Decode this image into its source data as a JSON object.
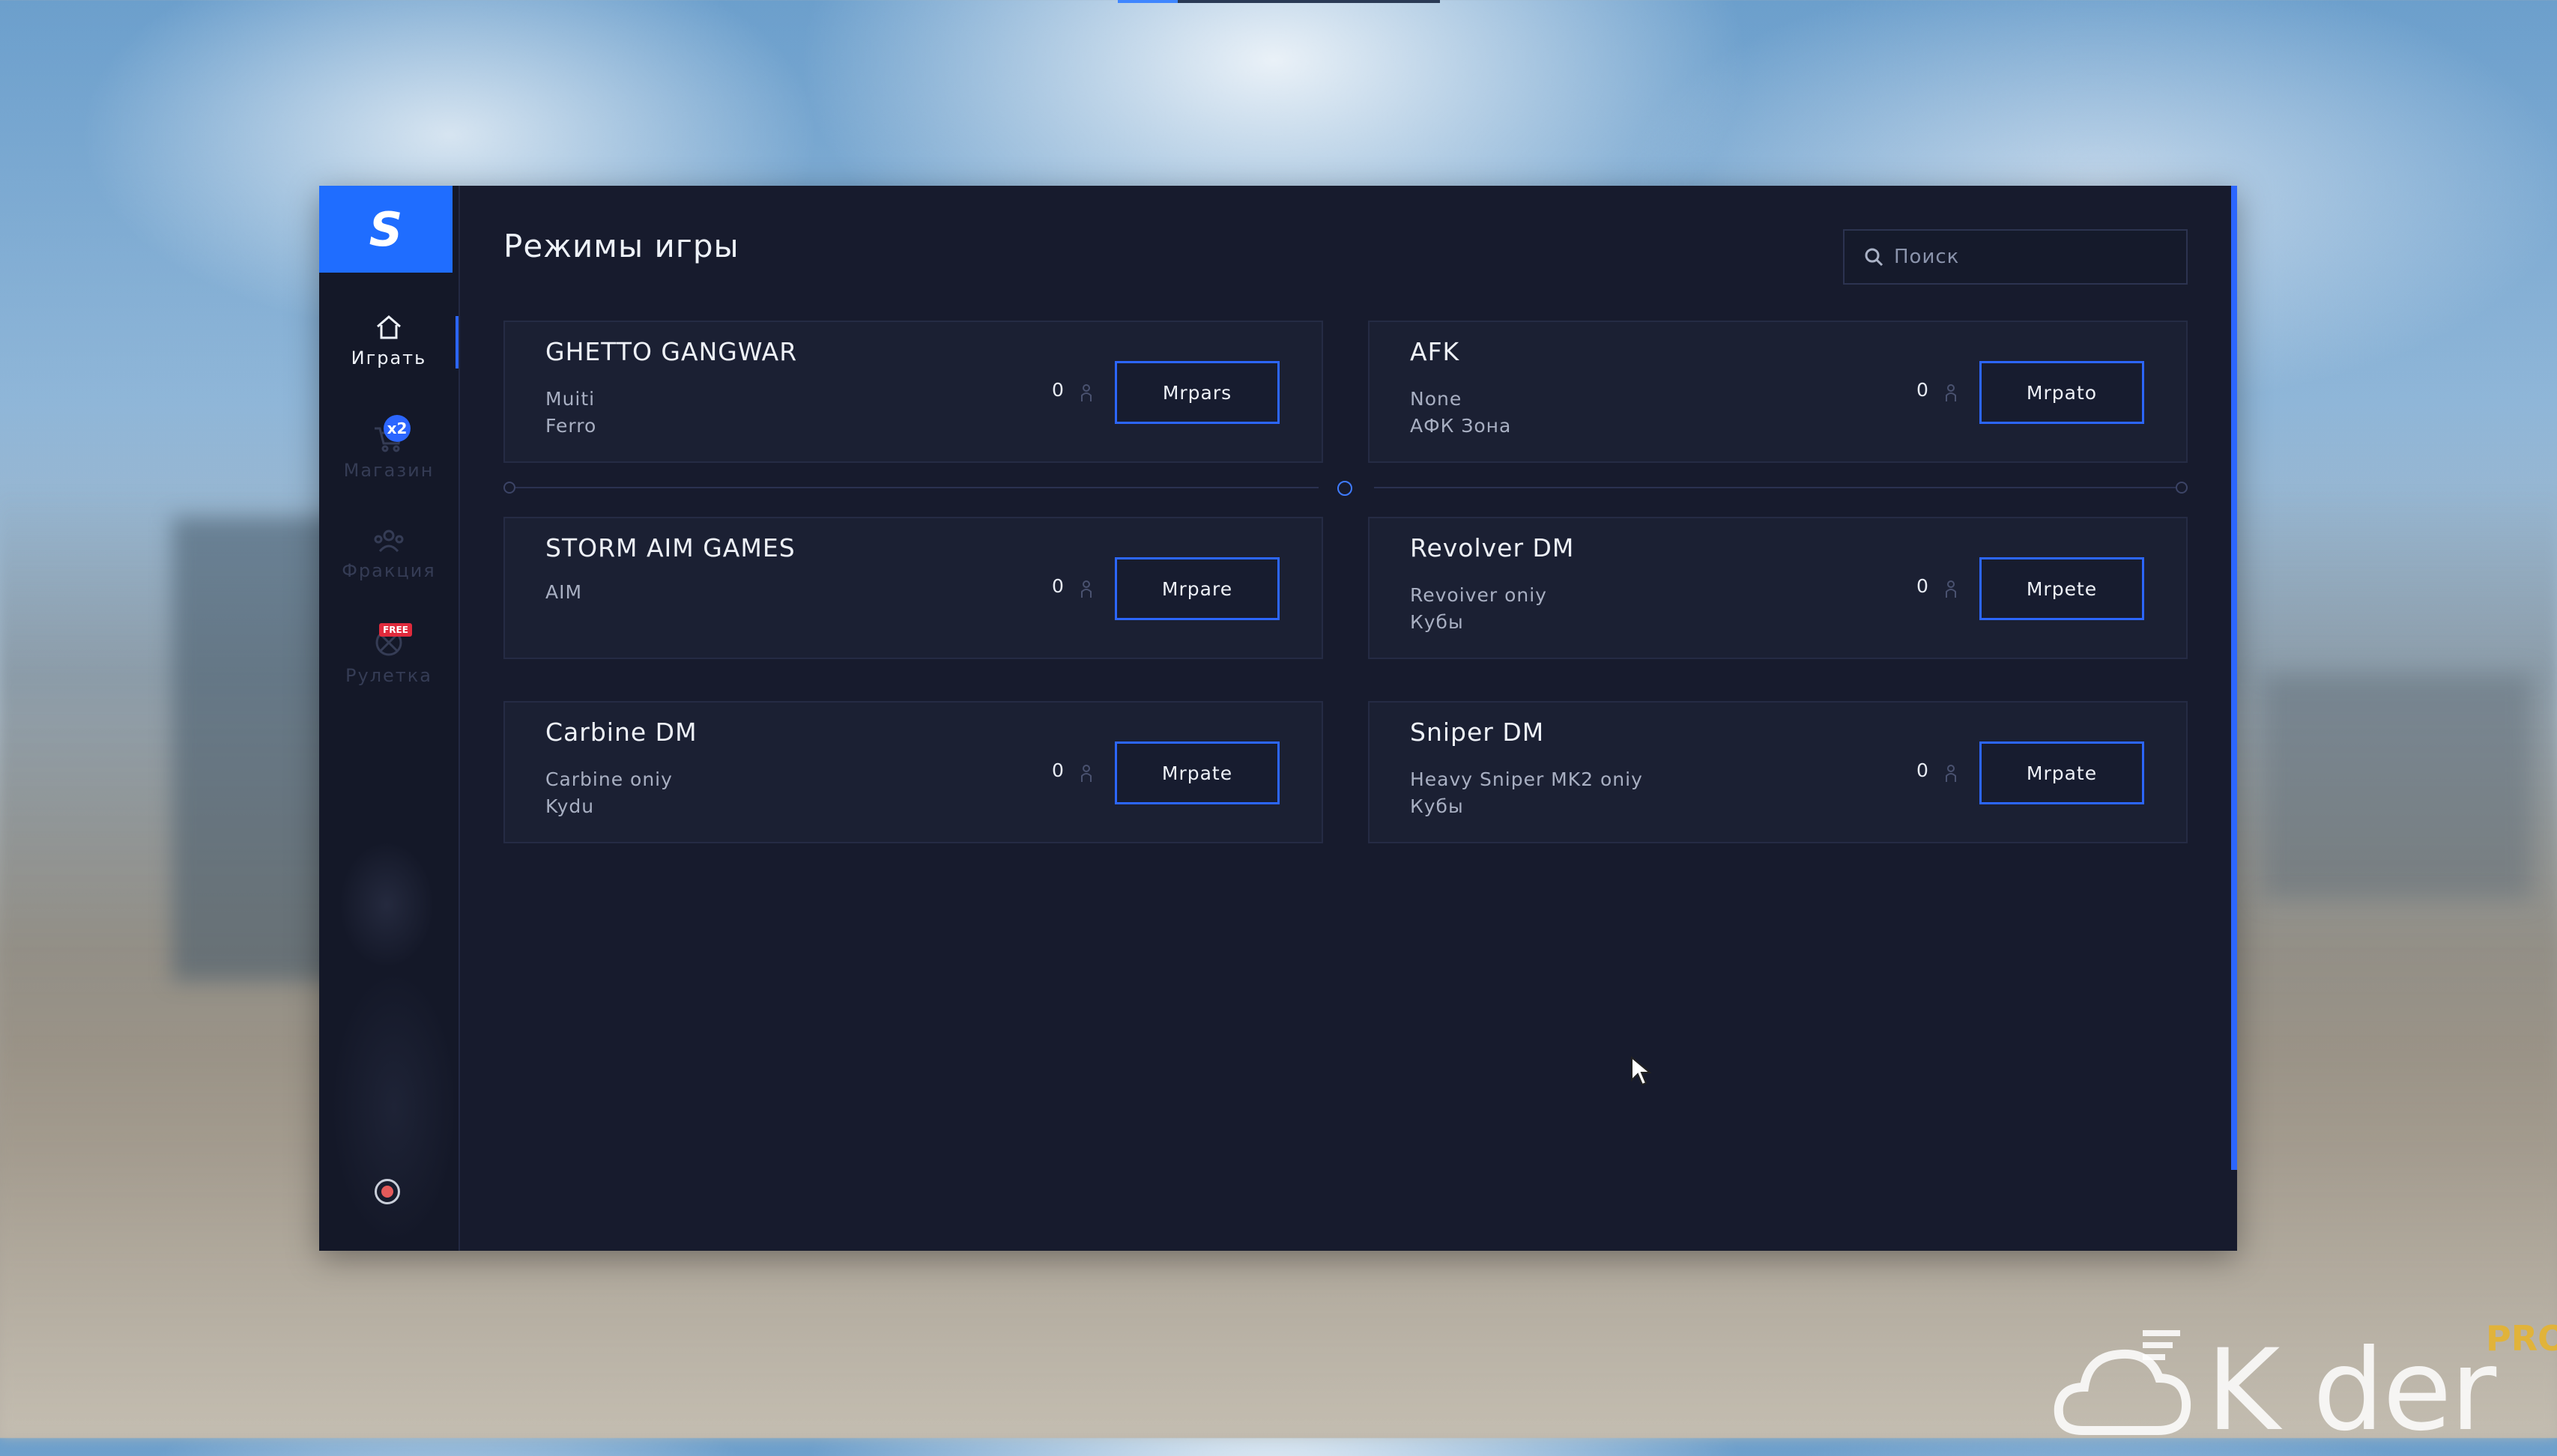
{
  "window": {
    "logo_letter": "S",
    "title": "Режимы игры",
    "search": {
      "placeholder": "Поиск"
    }
  },
  "sidebar": {
    "items": [
      {
        "label": "Играть",
        "icon": "home-icon",
        "active": true
      },
      {
        "label": "Магазин",
        "icon": "shop-cart-icon",
        "badge": "x2"
      },
      {
        "label": "Фракция",
        "icon": "faction-people-icon"
      },
      {
        "label": "Рулетка",
        "icon": "roulette-icon",
        "badge": "FREE"
      }
    ],
    "bottom_icon": "record-icon"
  },
  "modes": [
    {
      "name": "GHETTO GANGWAR",
      "line1": "Muiti",
      "line2": "Ferro",
      "players": "0",
      "button": "Mrpars"
    },
    {
      "name": "AFK",
      "line1": "None",
      "line2": "АФК Зона",
      "players": "0",
      "button": "Mrpato"
    },
    {
      "name": "STORM AIM GAMES",
      "line1": "AIM",
      "line2": "",
      "players": "0",
      "button": "Mrpare"
    },
    {
      "name": "Revolver DM",
      "line1": "Revoiver oniy",
      "line2": "Кубы",
      "players": "0",
      "button": "Mrpete"
    },
    {
      "name": "Carbine DM",
      "line1": "Carbine oniy",
      "line2": "Kydu",
      "players": "0",
      "button": "Mrpate"
    },
    {
      "name": "Sniper DM",
      "line1": "Heavy Sniper MK2 oniy",
      "line2": "Кубы",
      "players": "0",
      "button": "Mrpate"
    }
  ],
  "watermark": {
    "brand": "K der",
    "tag": "PRO"
  },
  "colors": {
    "accent": "#2c66ff",
    "panel": "#171b2d",
    "card": "#1b2033",
    "badge_red": "#e02a3c"
  }
}
